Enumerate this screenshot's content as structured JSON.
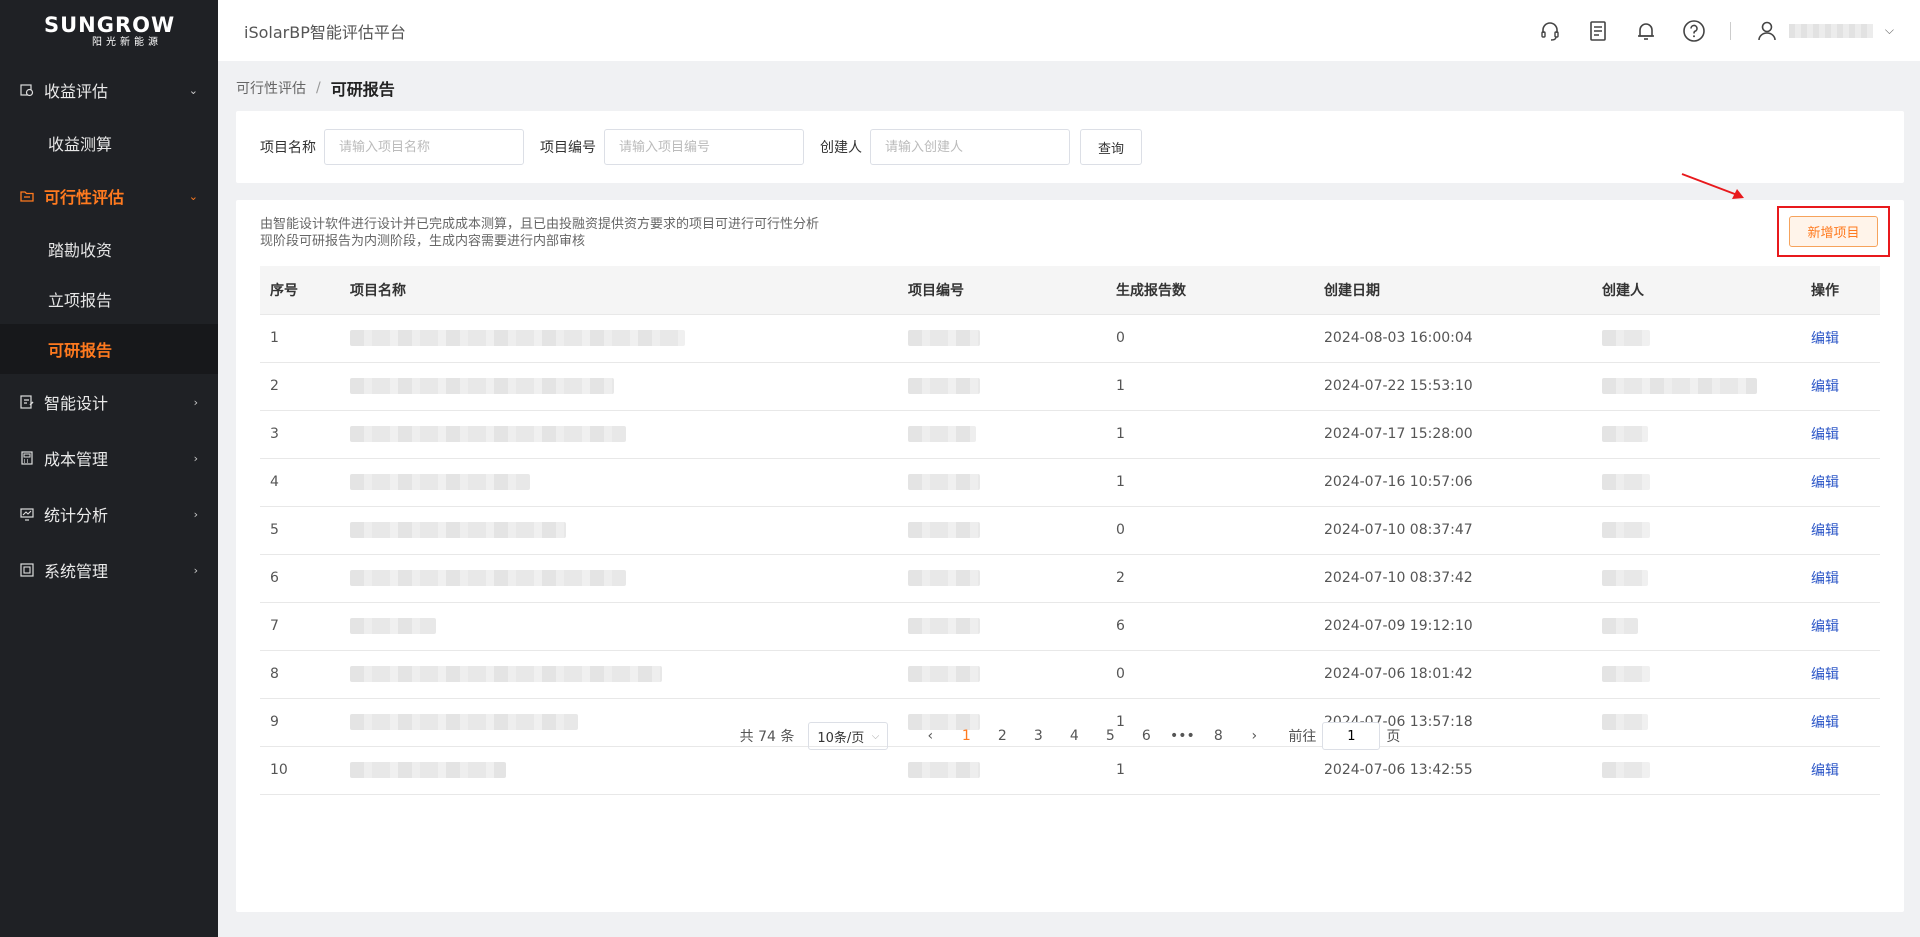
{
  "brand": {
    "name": "SUNGROW",
    "tagline": "阳光新能源"
  },
  "header": {
    "app_title": "iSolarBP智能评估平台"
  },
  "sidebar": {
    "groups": [
      {
        "label": "收益评估",
        "icon": "revenue-icon",
        "expanded": true,
        "items": [
          {
            "label": "收益测算"
          }
        ]
      },
      {
        "label": "可行性评估",
        "icon": "folder-icon",
        "expanded": true,
        "active": true,
        "items": [
          {
            "label": "踏勘收资"
          },
          {
            "label": "立项报告"
          },
          {
            "label": "可研报告",
            "active": true
          }
        ]
      },
      {
        "label": "智能设计",
        "icon": "design-icon"
      },
      {
        "label": "成本管理",
        "icon": "cost-icon"
      },
      {
        "label": "统计分析",
        "icon": "stats-icon"
      },
      {
        "label": "系统管理",
        "icon": "system-icon"
      }
    ]
  },
  "breadcrumb": {
    "parent": "可行性评估",
    "separator": "/",
    "current": "可研报告"
  },
  "search": {
    "name_label": "项目名称",
    "name_placeholder": "请输入项目名称",
    "code_label": "项目编号",
    "code_placeholder": "请输入项目编号",
    "creator_label": "创建人",
    "creator_placeholder": "请输入创建人",
    "query_label": "查询"
  },
  "notice": {
    "line1": "由智能设计软件进行设计并已完成成本测算，且已由投融资提供资方要求的项目可进行可行性分析",
    "line2": "现阶段可研报告为内测阶段，生成内容需要进行内部审核"
  },
  "add_button": "新增项目",
  "table": {
    "columns": [
      "序号",
      "项目名称",
      "项目编号",
      "生成报告数",
      "创建日期",
      "创建人",
      "操作"
    ],
    "rows": [
      {
        "index": "1",
        "count": "0",
        "date": "2024-08-03 16:00:04",
        "op": "编辑"
      },
      {
        "index": "2",
        "count": "1",
        "date": "2024-07-22 15:53:10",
        "op": "编辑"
      },
      {
        "index": "3",
        "count": "1",
        "date": "2024-07-17 15:28:00",
        "op": "编辑"
      },
      {
        "index": "4",
        "count": "1",
        "date": "2024-07-16 10:57:06",
        "op": "编辑"
      },
      {
        "index": "5",
        "count": "0",
        "date": "2024-07-10 08:37:47",
        "op": "编辑"
      },
      {
        "index": "6",
        "count": "2",
        "date": "2024-07-10 08:37:42",
        "op": "编辑"
      },
      {
        "index": "7",
        "count": "6",
        "date": "2024-07-09 19:12:10",
        "op": "编辑"
      },
      {
        "index": "8",
        "count": "0",
        "date": "2024-07-06 18:01:42",
        "op": "编辑"
      },
      {
        "index": "9",
        "count": "1",
        "date": "2024-07-06 13:57:18",
        "op": "编辑"
      },
      {
        "index": "10",
        "count": "1",
        "date": "2024-07-06 13:42:55",
        "op": "编辑"
      }
    ]
  },
  "pagination": {
    "total": "共 74 条",
    "page_size": "10条/页",
    "prev": "‹",
    "next": "›",
    "pages": [
      "1",
      "2",
      "3",
      "4",
      "5",
      "6",
      "•••",
      "8"
    ],
    "current": "1",
    "goto_label": "前往",
    "goto_value": "1",
    "goto_suffix": "页"
  },
  "colors": {
    "accent": "#ff7a1f",
    "link": "#2a55c7",
    "sidebar_bg": "#1f2125",
    "highlight_border": "#e8191c"
  }
}
